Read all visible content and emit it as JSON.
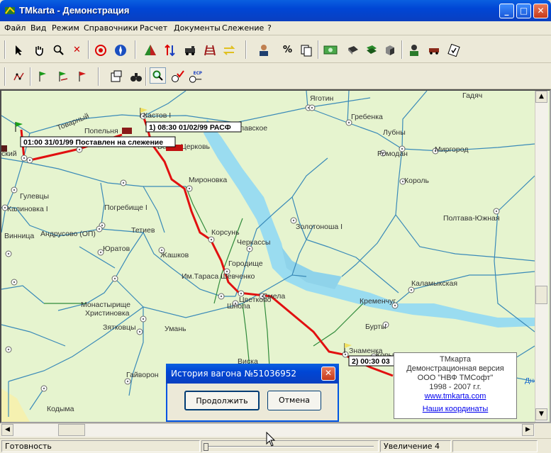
{
  "window": {
    "title": "TMkarta - Демонстрация",
    "minimize": "_",
    "maximize": "□",
    "close": "✕"
  },
  "menu": [
    "Файл",
    "Вид",
    "Режим",
    "Справочники",
    "Расчет",
    "Документы",
    "Слежение",
    "?"
  ],
  "toolbar2": {
    "percent": "%",
    "ecp": "ECP"
  },
  "stations": {
    "s1": "Кастов I",
    "s2": "Переяславское",
    "s3": "Яготин",
    "s4": "Гребенка",
    "s5": "Гадяч",
    "s6": "Товарный",
    "s7": "Попельня",
    "s8": "Белая Церковь",
    "s9": "Лубны",
    "s10": "Ромодан",
    "s11": "Миргород",
    "s12": "Мироновка",
    "s13": "Король",
    "s14": "Гулевцы",
    "s15": "Калиновка I",
    "s16": "Погребище I",
    "s17": "Винница",
    "s18": "Андрусово (ОП)",
    "s19": "Тетиев",
    "s20": "Корсунь",
    "s21": "Золотоноша I",
    "s22": "Полтава-Южная",
    "s23": "Черкассы",
    "s24": "Юратов",
    "s25": "Жашков",
    "s26": "Городище",
    "s27": "Им.Тараса Шевченко",
    "s28": "Смела",
    "s29": "Цветково",
    "s30": "Кременчуг",
    "s31": "Каламыкская",
    "s32": "Монастырище",
    "s33": "Христиновка",
    "s34": "Шпола",
    "s35": "Зятковцы",
    "s36": "Умань",
    "s37": "Бурты",
    "s38": "Знаменка",
    "s39": "Корыстовка",
    "s40": "Виска",
    "s41": "Гайворон",
    "s42": "Кодыма",
    "s43": "ский",
    "s44": "Днепр"
  },
  "route_labels": [
    "01:00 31/01/99 Поставлен на слежение",
    "1) 08:30 01/02/99 РАСФ",
    "2) 00:30 03"
  ],
  "dialog": {
    "title": "История вагона №51036952",
    "continue": "Продолжить",
    "cancel": "Отмена",
    "close": "✕"
  },
  "infobox": {
    "line1": "TMкарта",
    "line2": "Демонстрационная версия",
    "line3": "ООО \"НВФ ТМСофт\"",
    "line4": "1998 - 2007 г.г.",
    "link1": "www.tmkarta.com",
    "link2": "Наши координаты"
  },
  "status": {
    "ready": "Готовность",
    "zoom": "Увеличение 4"
  },
  "colors": {
    "route": "#e11010",
    "rail": "#3a8ab8",
    "rail2": "#2f8a3a",
    "land": "#e6f4cf",
    "water": "#9adcf0"
  }
}
